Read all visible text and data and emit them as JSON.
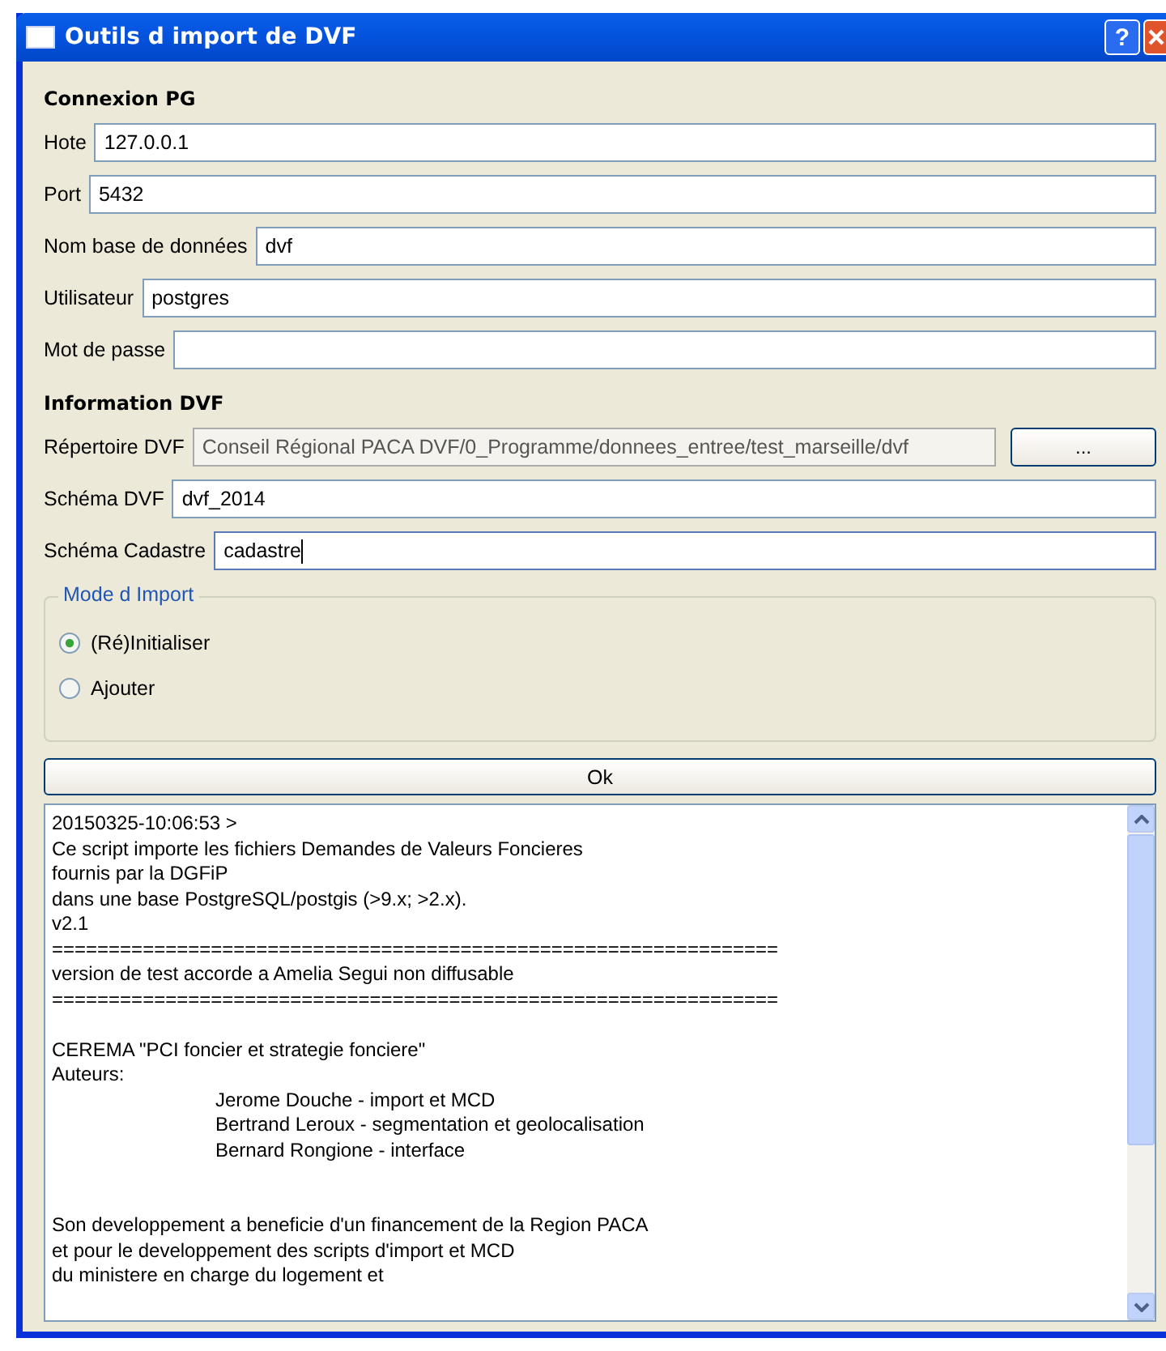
{
  "window": {
    "title": "Outils d import de DVF",
    "help_button": "?"
  },
  "connection": {
    "heading": "Connexion PG",
    "fields": [
      {
        "label": "Hote",
        "value": "127.0.0.1"
      },
      {
        "label": "Port",
        "value": "5432"
      },
      {
        "label": "Nom base de données",
        "value": "dvf"
      },
      {
        "label": "Utilisateur",
        "value": "postgres"
      },
      {
        "label": "Mot de passe"
      }
    ]
  },
  "dvf": {
    "heading": "Information DVF",
    "directory": {
      "label": "Répertoire DVF",
      "value": "Conseil Régional PACA DVF/0_Programme/donnees_entree/test_marseille/dvf",
      "disabled": true,
      "browse_button": "..."
    },
    "fields": [
      {
        "label": "Schéma DVF",
        "value": "dvf_2014",
        "focused": false
      },
      {
        "label": "Schéma Cadastre",
        "value": "cadastre",
        "focused": true
      }
    ]
  },
  "import_mode": {
    "title": "Mode d Import",
    "options": [
      {
        "label": "(Ré)Initialiser",
        "selected": true
      },
      {
        "label": "Ajouter",
        "selected": false
      }
    ]
  },
  "ok_button": "Ok",
  "log": [
    {
      "kind": "line",
      "text": "20150325-10:06:53 >"
    },
    {
      "kind": "line",
      "text": "Ce script importe les fichiers Demandes de Valeurs Foncieres"
    },
    {
      "kind": "line",
      "text": "fournis par la DGFiP"
    },
    {
      "kind": "line",
      "text": "dans une base PostgreSQL/postgis (>9.x; >2.x)."
    },
    {
      "kind": "line",
      "text": "v2.1"
    },
    {
      "kind": "line",
      "text": "================================================================"
    },
    {
      "kind": "line",
      "text": "version de test accorde a Amelia Segui non diffusable"
    },
    {
      "kind": "line",
      "text": "================================================================"
    },
    {
      "kind": "paragraph",
      "text": "CEREMA \"PCI foncier et strategie fonciere\""
    },
    {
      "kind": "line",
      "text": "Auteurs:"
    },
    {
      "kind": "indented",
      "text": "Jerome Douche - import et MCD"
    },
    {
      "kind": "indented",
      "text": "Bertrand Leroux - segmentation et geolocalisation"
    },
    {
      "kind": "indented",
      "text": "Bernard Rongione - interface"
    },
    {
      "kind": "section",
      "text": "Son developpement a beneficie d'un financement de la Region PACA"
    },
    {
      "kind": "line",
      "text": "et pour le developpement des scripts d'import et MCD"
    },
    {
      "kind": "line",
      "text": "du ministere en charge du logement et"
    }
  ]
}
